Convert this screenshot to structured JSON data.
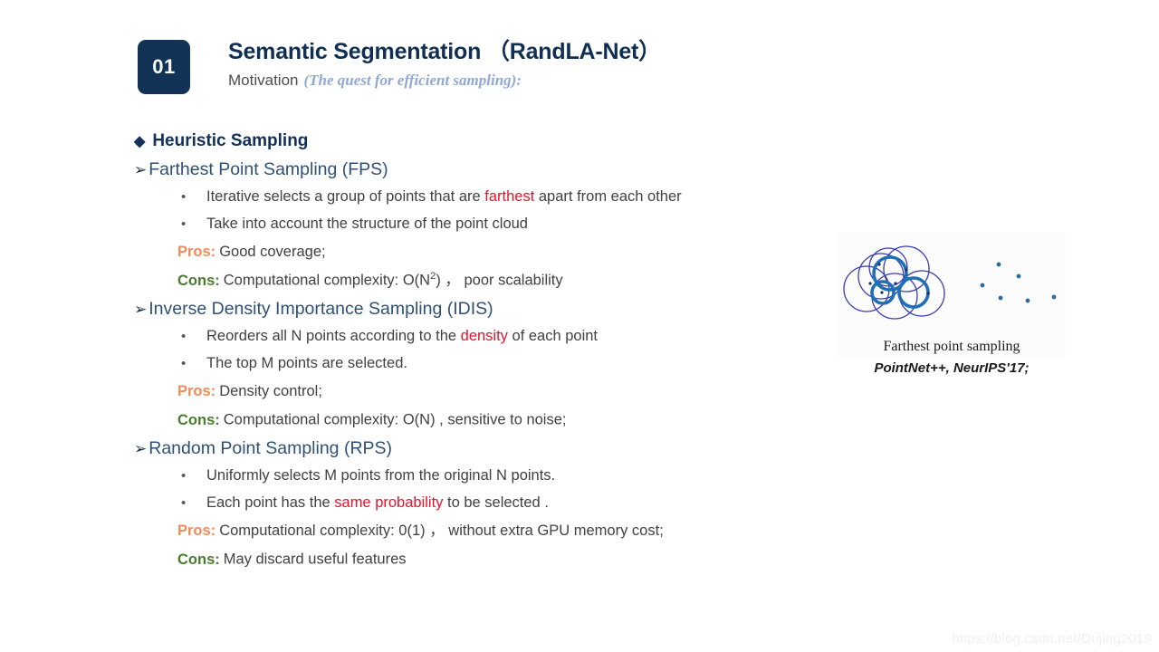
{
  "header": {
    "badge": "01",
    "title": "Semantic Segmentation （RandLA-Net）",
    "subtitle_main": "Motivation",
    "subtitle_em": "(The quest for efficient sampling):"
  },
  "section": {
    "diamond": "◆",
    "heading": "Heuristic Sampling"
  },
  "groups": [
    {
      "arrow": "➢",
      "title": "Farthest Point Sampling (FPS)",
      "bullets": [
        {
          "marker": "•",
          "pre": "Iterative selects a group of points that are ",
          "hl": "farthest",
          "post": " apart from each other"
        },
        {
          "marker": "•",
          "pre": "Take into account the structure of the point cloud",
          "hl": "",
          "post": ""
        }
      ],
      "pros_label": "Pros:",
      "pros_text": "Good coverage;",
      "cons_label": "Cons:",
      "cons_pre": "Computational complexity: O(N",
      "cons_sup": "2",
      "cons_post": ") ，  poor scalability"
    },
    {
      "arrow": "➢",
      "title": "Inverse Density Importance Sampling (IDIS)",
      "bullets": [
        {
          "marker": "•",
          "pre": "Reorders all N points according to the ",
          "hl": "density",
          "post": " of each point"
        },
        {
          "marker": "•",
          "pre": "The top M points are selected.",
          "hl": "",
          "post": ""
        }
      ],
      "pros_label": "Pros:",
      "pros_text": "Density control;",
      "cons_label": "Cons:",
      "cons_pre": "Computational complexity: O(N) , sensitive to noise;",
      "cons_sup": "",
      "cons_post": ""
    },
    {
      "arrow": "➢",
      "title": "Random Point Sampling (RPS)",
      "bullets": [
        {
          "marker": "•",
          "pre": "Uniformly selects M points from the original N points.",
          "hl": "",
          "post": ""
        },
        {
          "marker": "•",
          "pre": "Each point has the ",
          "hl": "same probability",
          "post": " to be selected ."
        }
      ],
      "pros_label": "Pros:",
      "pros_text": "Computational complexity: 0(1) ，  without extra GPU memory cost;",
      "cons_label": "Cons:",
      "cons_pre": "May discard useful features",
      "cons_sup": "",
      "cons_post": ""
    }
  ],
  "figure": {
    "inner_caption": "Farthest point sampling",
    "below_caption": "PointNet++, NeurIPS'17;",
    "circle_color": "#3b3bb0",
    "thick_circle_color": "#1f6fb5",
    "dot_color": "#2b6ca3"
  },
  "watermark": "https://blog.csdn.net/Dujing2019"
}
